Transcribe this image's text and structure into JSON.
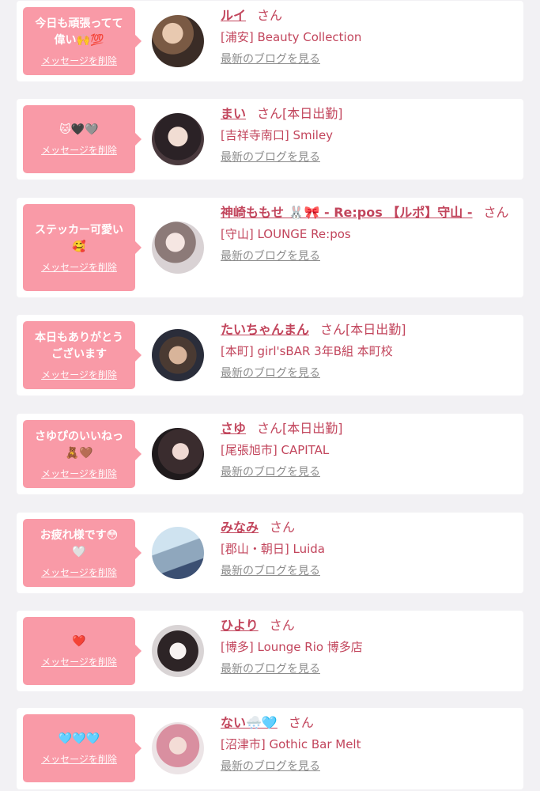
{
  "delete_label": "メッセージを削除",
  "blog_label": "最新のブログを見る",
  "san_label": "さん",
  "items": [
    {
      "message": "今日も頑張ってて\n偉い🙌💯",
      "name": "ルイ",
      "badge": "",
      "shop": "[浦安] Beauty Collection"
    },
    {
      "message": "🐱🖤🩶",
      "name": "まい",
      "badge": "[本日出勤]",
      "shop": "[吉祥寺南口] Smiley"
    },
    {
      "message": "ステッカー可愛い\n🥰",
      "name": "神崎ももせ 🐰🎀 - Re:pos 【ルポ】守山 -",
      "badge": "",
      "shop": "[守山] LOUNGE Re:pos"
    },
    {
      "message": "本日もありがとう\nございます",
      "name": "たいちゃんまん",
      "badge": "[本日出勤]",
      "shop": "[本町] girl'sBAR 3年B組 本町校"
    },
    {
      "message": "さゆぴのいいねっ\n🧸🤎",
      "name": "さゆ",
      "badge": "[本日出勤]",
      "shop": "[尾張旭市] CAPITAL"
    },
    {
      "message": "お疲れ様です😳\n🤍",
      "name": "みなみ",
      "badge": "",
      "shop": "[郡山・朝日] Luida"
    },
    {
      "message": "❤️",
      "name": "ひより",
      "badge": "",
      "shop": "[博多] Lounge Rio 博多店"
    },
    {
      "message": "🩵🩵🩵",
      "name": "ない🌨️🩵",
      "badge": "",
      "shop": "[沼津市] Gothic Bar Melt"
    }
  ]
}
